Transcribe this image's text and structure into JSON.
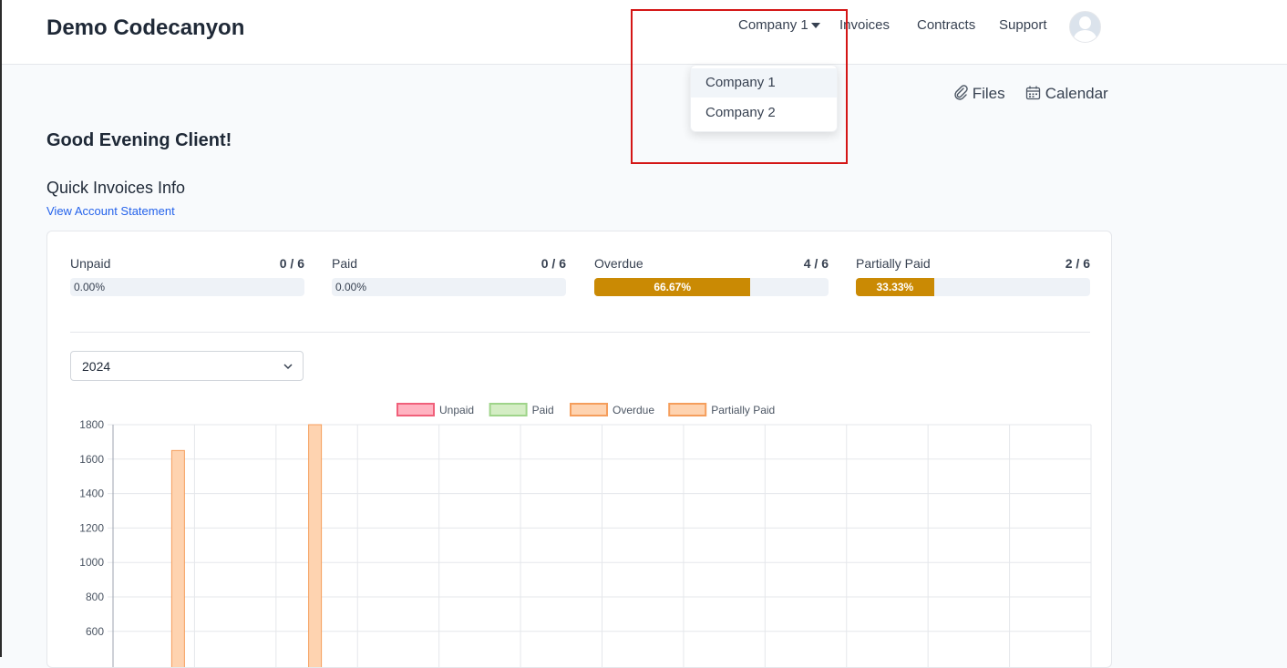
{
  "header": {
    "brand": "Demo Codecanyon",
    "nav": {
      "company": "Company 1",
      "invoices": "Invoices",
      "contracts": "Contracts",
      "support": "Support"
    }
  },
  "company_dropdown": {
    "items": [
      {
        "label": "Company 1",
        "active": true
      },
      {
        "label": "Company 2",
        "active": false
      }
    ]
  },
  "quick_links": {
    "files": "Files",
    "calendar": "Calendar"
  },
  "greeting": "Good Evening Client!",
  "invoices_section": {
    "title": "Quick Invoices Info",
    "statement_link": "View Account Statement",
    "stats": [
      {
        "label": "Unpaid",
        "count": "0 / 6",
        "percent": 0,
        "percent_label": "0.00%"
      },
      {
        "label": "Paid",
        "count": "0 / 6",
        "percent": 0,
        "percent_label": "0.00%"
      },
      {
        "label": "Overdue",
        "count": "4 / 6",
        "percent": 66.67,
        "percent_label": "66.67%"
      },
      {
        "label": "Partially Paid",
        "count": "2 / 6",
        "percent": 33.33,
        "percent_label": "33.33%"
      }
    ],
    "year_select": "2024"
  },
  "chart_data": {
    "type": "bar",
    "legend": [
      {
        "name": "Unpaid",
        "fill": "#ffb3c1",
        "stroke": "#f0607a"
      },
      {
        "name": "Paid",
        "fill": "#d4edc4",
        "stroke": "#9fd48a"
      },
      {
        "name": "Overdue",
        "fill": "#fed3b0",
        "stroke": "#f59e5c"
      },
      {
        "name": "Partially Paid",
        "fill": "#fed3b0",
        "stroke": "#f59e5c"
      }
    ],
    "legend_position": "top",
    "y_ticks": [
      1800,
      1600,
      1400,
      1200,
      1000,
      800,
      600
    ],
    "ylim_visible": [
      450,
      1800
    ],
    "grid": true,
    "visible_bars": [
      {
        "category_index": 0,
        "series": "Partially Paid",
        "value": 1650
      },
      {
        "category_index": 2,
        "series": "Overdue",
        "value": 1800
      }
    ]
  },
  "colors": {
    "progress_fill": "#ca8a04",
    "link": "#2563eb",
    "highlight_box": "#d41616"
  }
}
